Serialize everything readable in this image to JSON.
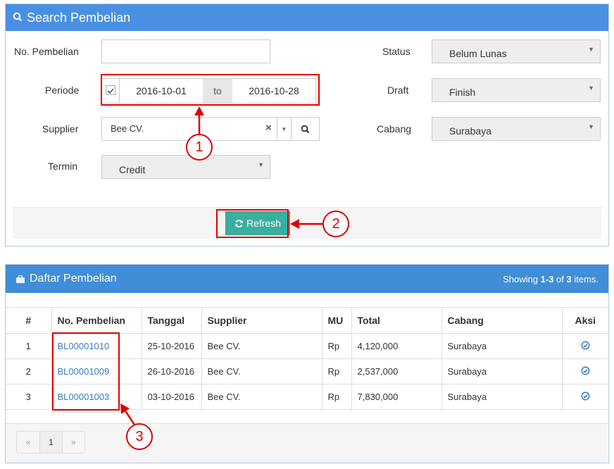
{
  "search_panel": {
    "title": "Search Pembelian"
  },
  "form": {
    "no_pembelian_label": "No. Pembelian",
    "no_pembelian_value": "",
    "periode_label": "Periode",
    "date_from": "2016-10-01",
    "date_to_sep": "to",
    "date_to": "2016-10-28",
    "supplier_label": "Supplier",
    "supplier_value": "Bee CV.",
    "clear_glyph": "×",
    "caret_glyph": "▼",
    "termin_label": "Termin",
    "termin_value": "Credit",
    "status_label": "Status",
    "status_value": "Belum Lunas",
    "draft_label": "Draft",
    "draft_value": "Finish",
    "cabang_label": "Cabang",
    "cabang_value": "Surabaya",
    "refresh_label": "Refresh"
  },
  "markers": [
    "1",
    "2",
    "3"
  ],
  "list_panel": {
    "title": "Daftar Pembelian",
    "showing_prefix": "Showing ",
    "showing_range": "1-3",
    "showing_of": " of ",
    "showing_total": "3",
    "showing_suffix": " items."
  },
  "table": {
    "headers": [
      "#",
      "No. Pembelian",
      "Tanggal",
      "Supplier",
      "MU",
      "Total",
      "Cabang",
      "Aksi"
    ],
    "rows": [
      [
        "1",
        "BL00001010",
        "25-10-2016",
        "Bee CV.",
        "Rp",
        "4,120,000",
        "Surabaya"
      ],
      [
        "2",
        "BL00001009",
        "26-10-2016",
        "Bee CV.",
        "Rp",
        "2,537,000",
        "Surabaya"
      ],
      [
        "3",
        "BL00001003",
        "03-10-2016",
        "Bee CV.",
        "Rp",
        "7,830,000",
        "Surabaya"
      ]
    ]
  },
  "pager": {
    "prev": "«",
    "page": "1",
    "next": "»"
  },
  "colors": {
    "header_blue": "#4a90e2",
    "refresh_green": "#3aaf9f",
    "annotation_red": "#e00000",
    "link_blue": "#3a7bc8"
  }
}
